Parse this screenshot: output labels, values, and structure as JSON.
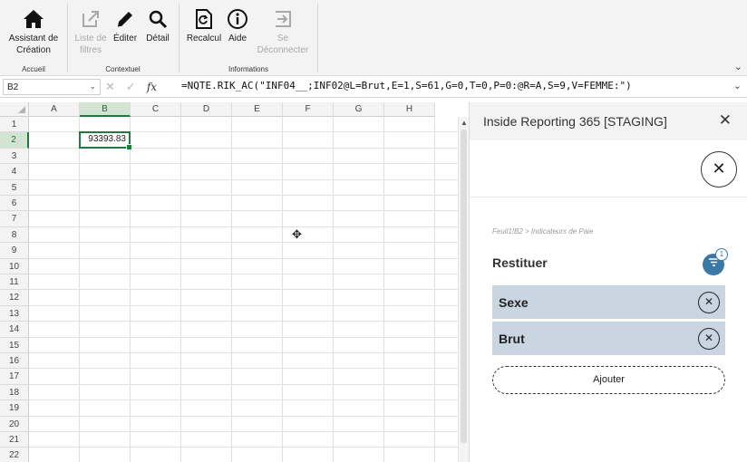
{
  "ribbon": {
    "groups": [
      {
        "label": "Accueil"
      },
      {
        "label": "Contextuel"
      },
      {
        "label": "Informations"
      }
    ],
    "buttons": [
      {
        "label1": "Assistant de",
        "label2": "Création",
        "icon": "home-icon",
        "disabled": false
      },
      {
        "label1": "Liste de",
        "label2": "filtres",
        "icon": "external-link-icon",
        "disabled": true
      },
      {
        "label1": "Éditer",
        "label2": "",
        "icon": "pencil-icon",
        "disabled": false
      },
      {
        "label1": "Détail",
        "label2": "",
        "icon": "search-icon",
        "disabled": false
      },
      {
        "label1": "Recalcul",
        "label2": "",
        "icon": "refresh-doc-icon",
        "disabled": false
      },
      {
        "label1": "Aide",
        "label2": "",
        "icon": "info-icon",
        "disabled": false
      },
      {
        "label1": "Se",
        "label2": "Déconnecter",
        "icon": "logout-icon",
        "disabled": true
      }
    ]
  },
  "formula_bar": {
    "name_box": "B2",
    "formula": "=NQTE.RIK_AC(\"INF04__;INF02@L=Brut,E=1,S=61,G=0,T=0,P=0:@R=A,S=9,V=FEMME:\")",
    "fx": "fx"
  },
  "sheet": {
    "columns": [
      "A",
      "B",
      "C",
      "D",
      "E",
      "F",
      "G",
      "H"
    ],
    "rows": [
      "1",
      "2",
      "3",
      "4",
      "5",
      "6",
      "7",
      "8",
      "9",
      "10",
      "11",
      "12",
      "13",
      "14",
      "15",
      "16",
      "17",
      "18",
      "19",
      "20",
      "21",
      "22"
    ],
    "active_cell": "B2",
    "active_value": "93393.83"
  },
  "panel": {
    "title": "Inside Reporting 365 [STAGING]",
    "close": "✕",
    "circle_close": "✕",
    "breadcrumb": "Feuil1!B2  >  Indicateurs de Paie",
    "section_title": "Restituer",
    "filter_count": "1",
    "chips": [
      {
        "label": "Sexe"
      },
      {
        "label": "Brut"
      }
    ],
    "add_label": "Ajouter"
  }
}
